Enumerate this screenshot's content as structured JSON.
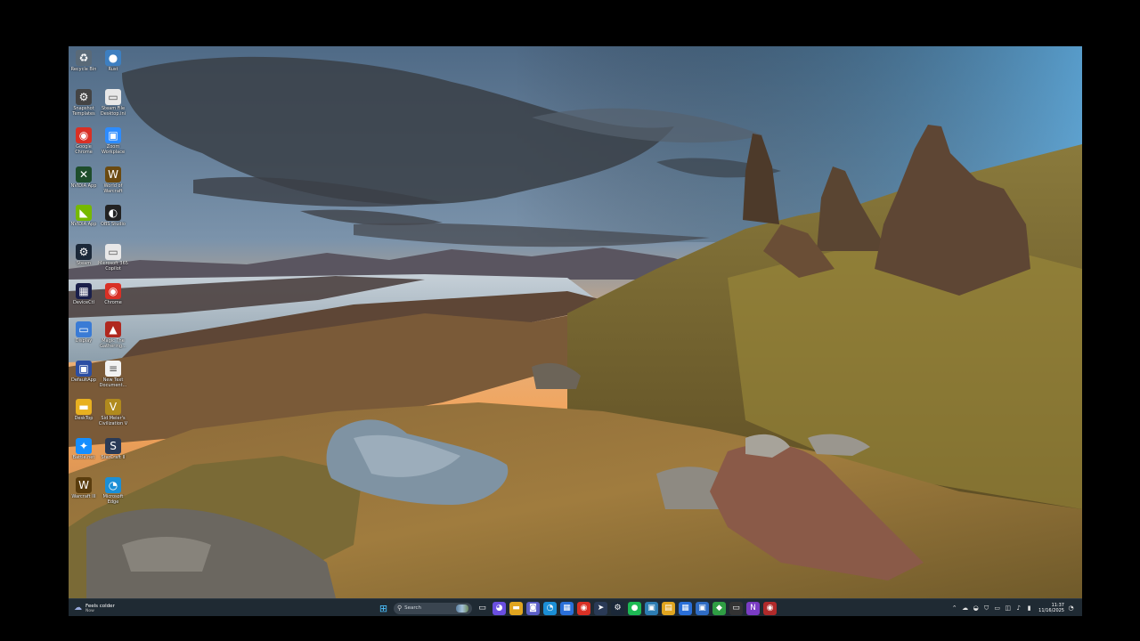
{
  "desktop_icons": [
    {
      "label": "Recycle Bin",
      "icon": "recycle-bin-icon",
      "glyph": "♻",
      "bg": "#5a6a78"
    },
    {
      "label": "Rust",
      "icon": "globe-icon",
      "glyph": "●",
      "bg": "#3d7fc1"
    },
    {
      "label": "Snapshot Templates",
      "icon": "settings-icon",
      "glyph": "⚙",
      "bg": "#444"
    },
    {
      "label": "Steam File Desktop.ini",
      "icon": "file-icon",
      "glyph": "▭",
      "bg": "#e8e8e8"
    },
    {
      "label": "Google Chrome",
      "icon": "chrome-icon",
      "glyph": "◉",
      "bg": "#d93025"
    },
    {
      "label": "Zoom Workplace",
      "icon": "zoom-icon",
      "glyph": "▣",
      "bg": "#2d8cff"
    },
    {
      "label": "NVIDIA App",
      "icon": "terminal-icon",
      "glyph": "✕",
      "bg": "#1e4d2b"
    },
    {
      "label": "World of Warcraft",
      "icon": "warcraft-icon",
      "glyph": "W",
      "bg": "#6b4a10"
    },
    {
      "label": "NVIDIA App",
      "icon": "nvidia-icon",
      "glyph": "◣",
      "bg": "#76b900"
    },
    {
      "label": "OBS Studio",
      "icon": "obs-icon",
      "glyph": "◐",
      "bg": "#222"
    },
    {
      "label": "Steam",
      "icon": "steam-icon",
      "glyph": "⚙",
      "bg": "#1b2838"
    },
    {
      "label": "Microsoft 365 Copilot",
      "icon": "file-icon",
      "glyph": "▭",
      "bg": "#e8e8e8"
    },
    {
      "label": "DeviceCtl",
      "icon": "grid-icon",
      "glyph": "▦",
      "bg": "#1a1f4a"
    },
    {
      "label": "Chrome",
      "icon": "chrome-icon",
      "glyph": "◉",
      "bg": "#d93025"
    },
    {
      "label": "Display",
      "icon": "monitor-icon",
      "glyph": "▭",
      "bg": "#3a7bd5"
    },
    {
      "label": "Magic The Gathering...",
      "icon": "mtg-icon",
      "glyph": "▲",
      "bg": "#b0281f"
    },
    {
      "label": "DefaultApp",
      "icon": "app-icon",
      "glyph": "▣",
      "bg": "#2c4ea3"
    },
    {
      "label": "New Text Document...",
      "icon": "text-document-icon",
      "glyph": "≡",
      "bg": "#f2f2f2"
    },
    {
      "label": "DeskTop",
      "icon": "folder-icon",
      "glyph": "▬",
      "bg": "#e8b020"
    },
    {
      "label": "Sid Meier's Civilization V",
      "icon": "civ-icon",
      "glyph": "V",
      "bg": "#b08a1e"
    },
    {
      "label": "Battle.net",
      "icon": "battlenet-icon",
      "glyph": "✦",
      "bg": "#148eff"
    },
    {
      "label": "StarCraft II",
      "icon": "starcraft-icon",
      "glyph": "S",
      "bg": "#2a3a56"
    },
    {
      "label": "Warcraft III",
      "icon": "warcraft-icon",
      "glyph": "W",
      "bg": "#5a3d0e"
    },
    {
      "label": "Microsoft Edge",
      "icon": "edge-icon",
      "glyph": "◔",
      "bg": "#1b8fd6"
    }
  ],
  "weather": {
    "line1": "Feels colder",
    "line2": "Now"
  },
  "search": {
    "placeholder": "Search"
  },
  "taskbar_apps": [
    {
      "icon": "task-view-icon",
      "glyph": "▭",
      "bg": "transparent"
    },
    {
      "icon": "colorful-app-icon",
      "glyph": "◕",
      "bg": "#6a4fe0"
    },
    {
      "icon": "file-explorer-icon",
      "glyph": "▬",
      "bg": "#e0a520"
    },
    {
      "icon": "teams-icon",
      "glyph": "◙",
      "bg": "#5b5fc7"
    },
    {
      "icon": "edge-icon",
      "glyph": "◔",
      "bg": "#1b8fd6"
    },
    {
      "icon": "store-icon",
      "glyph": "▦",
      "bg": "#2a6fd8"
    },
    {
      "icon": "chrome-icon",
      "glyph": "◉",
      "bg": "#d93025"
    },
    {
      "icon": "send-icon",
      "glyph": "➤",
      "bg": "#2a3a56"
    },
    {
      "icon": "steam-icon",
      "glyph": "⚙",
      "bg": "#1b2838"
    },
    {
      "icon": "spotify-icon",
      "glyph": "●",
      "bg": "#1db954"
    },
    {
      "icon": "photos-icon",
      "glyph": "▣",
      "bg": "#2d7db3"
    },
    {
      "icon": "notes-icon",
      "glyph": "▤",
      "bg": "#e0a520"
    },
    {
      "icon": "calendar-icon",
      "glyph": "▦",
      "bg": "#2a6fd8"
    },
    {
      "icon": "windows-app-icon",
      "glyph": "▣",
      "bg": "#2f6cc4"
    },
    {
      "icon": "xbox-icon",
      "glyph": "◆",
      "bg": "#2f9e44"
    },
    {
      "icon": "terminal-icon",
      "glyph": "▭",
      "bg": "#333"
    },
    {
      "icon": "onenote-icon",
      "glyph": "N",
      "bg": "#7a3cc4"
    },
    {
      "icon": "chrome-beta-icon",
      "glyph": "◉",
      "bg": "#b02a2a"
    }
  ],
  "tray": {
    "time": "11:37",
    "date": "11/16/2025"
  }
}
